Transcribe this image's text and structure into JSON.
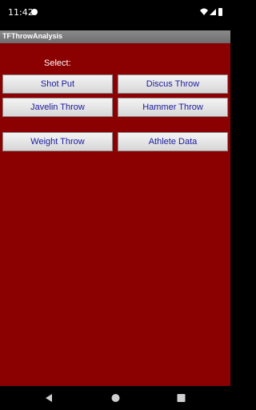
{
  "status_bar": {
    "time": "11:42"
  },
  "app": {
    "title": "TFThrowAnalysis"
  },
  "main": {
    "select_label": "Select:",
    "buttons": {
      "shot_put": "Shot Put",
      "discus_throw": "Discus Throw",
      "javelin_throw": "Javelin Throw",
      "hammer_throw": "Hammer Throw",
      "weight_throw": "Weight Throw",
      "athlete_data": "Athlete Data"
    }
  },
  "colors": {
    "background": "#8b0000",
    "button_text": "#1a1aa0",
    "title_bar": "#7a7a7a"
  },
  "icons": {
    "status": [
      "wifi-icon",
      "signal-icon",
      "battery-icon"
    ],
    "nav": [
      "back-icon",
      "home-icon",
      "recents-icon"
    ]
  }
}
